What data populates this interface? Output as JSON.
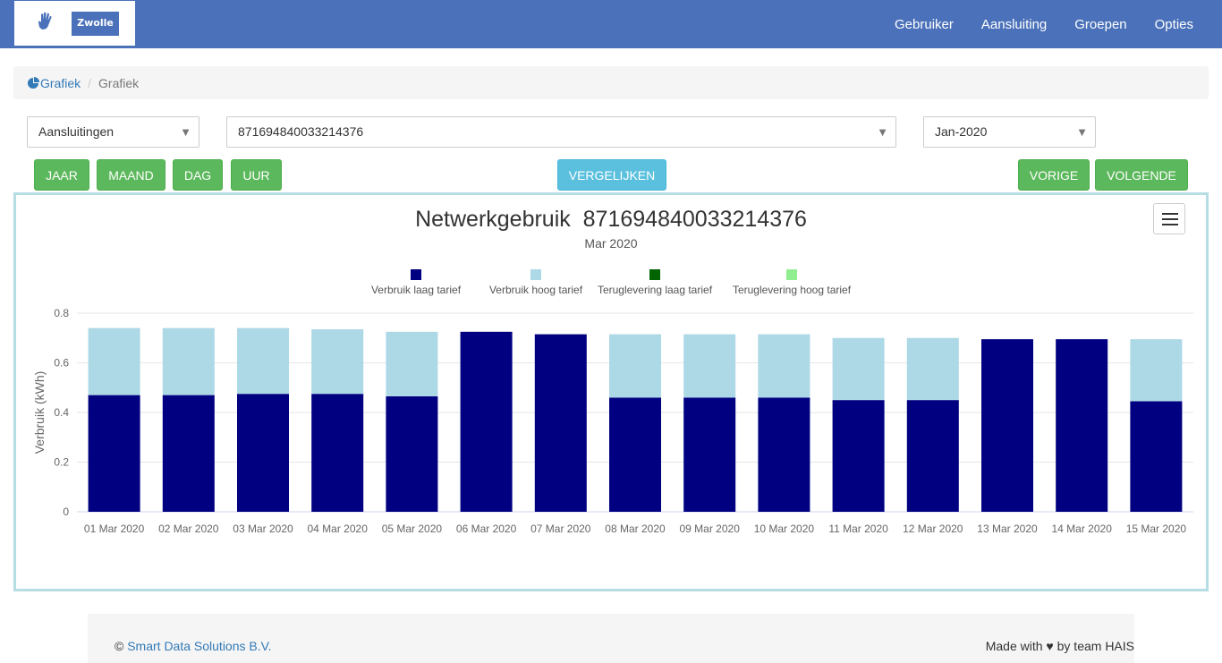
{
  "navbar": {
    "logo_text": "Zwolle",
    "links": [
      "Gebruiker",
      "Aansluiting",
      "Groepen",
      "Opties"
    ]
  },
  "breadcrumb": {
    "link": "Grafiek",
    "active": "Grafiek"
  },
  "filters": {
    "type_select": "Aansluitingen",
    "connection_select": "871694840033214376",
    "period_select": "Jan-2020"
  },
  "buttons": {
    "jaar": "JAAR",
    "maand": "MAAND",
    "dag": "DAG",
    "uur": "UUR",
    "vergelijken": "VERGELIJKEN",
    "vorige": "VORIGE",
    "volgende": "VOLGENDE"
  },
  "chart_data": {
    "type": "bar",
    "stacked": true,
    "title": "Netwerkgebruik  871694840033214376",
    "subtitle": "Mar 2020",
    "ylabel": "Verbruik (kWh)",
    "ylim": [
      0,
      0.8
    ],
    "yticks": [
      "0",
      "0.2",
      "0.4",
      "0.6",
      "0.8"
    ],
    "grid": true,
    "legend_position": "top",
    "categories": [
      "01 Mar 2020",
      "02 Mar 2020",
      "03 Mar 2020",
      "04 Mar 2020",
      "05 Mar 2020",
      "06 Mar 2020",
      "07 Mar 2020",
      "08 Mar 2020",
      "09 Mar 2020",
      "10 Mar 2020",
      "11 Mar 2020",
      "12 Mar 2020",
      "13 Mar 2020",
      "14 Mar 2020",
      "15 Mar 2020"
    ],
    "series": [
      {
        "name": "Verbruik laag tarief",
        "color": "#000080",
        "values": [
          0.47,
          0.47,
          0.475,
          0.475,
          0.465,
          0.725,
          0.715,
          0.46,
          0.46,
          0.46,
          0.45,
          0.45,
          0.695,
          0.695,
          0.445
        ]
      },
      {
        "name": "Verbruik hoog tarief",
        "color": "#add8e6",
        "values": [
          0.27,
          0.27,
          0.265,
          0.26,
          0.26,
          0,
          0,
          0.255,
          0.255,
          0.255,
          0.25,
          0.25,
          0,
          0,
          0.25
        ]
      },
      {
        "name": "Teruglevering laag tarief",
        "color": "#006400",
        "values": [
          0,
          0,
          0,
          0,
          0,
          0,
          0,
          0,
          0,
          0,
          0,
          0,
          0,
          0,
          0
        ]
      },
      {
        "name": "Teruglevering hoog tarief",
        "color": "#90ee90",
        "values": [
          0,
          0,
          0,
          0,
          0,
          0,
          0,
          0,
          0,
          0,
          0,
          0,
          0,
          0,
          0
        ]
      }
    ]
  },
  "footer": {
    "copyright": "©",
    "company": "Smart Data Solutions B.V.",
    "made_with": "Made with",
    "by_team": "by team HAIS"
  }
}
